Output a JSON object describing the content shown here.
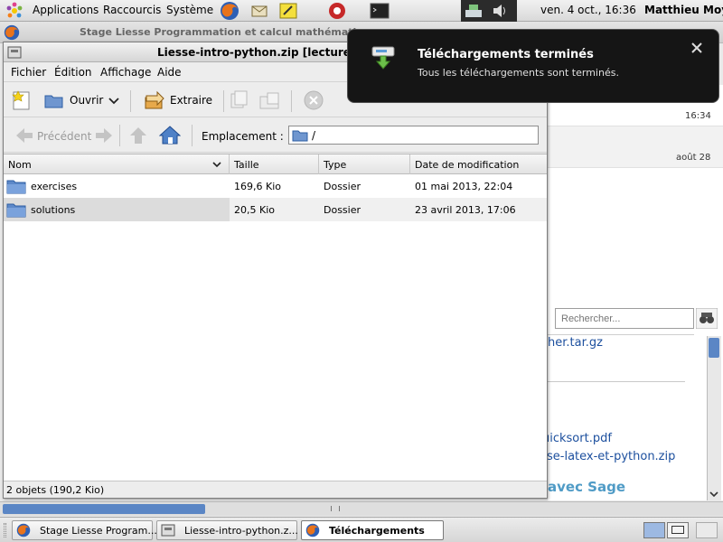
{
  "top_panel": {
    "menus": [
      "Applications",
      "Raccourcis",
      "Système"
    ],
    "clock": "ven.  4 oct., 16:36",
    "user": "Matthieu Moy"
  },
  "firefox": {
    "title": "Stage Liesse Programmation et calcul mathématique",
    "row_times": [
      "16:34",
      "août 28"
    ],
    "search_placeholder": "Rechercher...",
    "links": [
      "her.tar.gz",
      "uicksort.pdf",
      "se-latex-et-python.zip"
    ],
    "heading": "avec Sage"
  },
  "file_roller": {
    "title": "Liesse-intro-python.zip [lecture seule]",
    "menus": [
      "Fichier",
      "Édition",
      "Affichage",
      "Aide"
    ],
    "toolbar": {
      "open": "Ouvrir",
      "extract": "Extraire"
    },
    "location_bar": {
      "back": "Précédent",
      "location_label": "Emplacement :",
      "path": "/"
    },
    "columns": [
      "Nom",
      "Taille",
      "Type",
      "Date de modification"
    ],
    "rows": [
      {
        "name": "exercises",
        "size": "169,6 Kio",
        "type": "Dossier",
        "date": "01 mai 2013, 22:04"
      },
      {
        "name": "solutions",
        "size": "20,5 Kio",
        "type": "Dossier",
        "date": "23 avril 2013, 17:06"
      }
    ],
    "status": "2 objets (190,2 Kio)"
  },
  "notification": {
    "title": "Téléchargements terminés",
    "body": "Tous les téléchargements sont terminés."
  },
  "taskbar": {
    "tasks": [
      "Stage Liesse Program...",
      "Liesse-intro-python.z...",
      "Téléchargements"
    ]
  }
}
